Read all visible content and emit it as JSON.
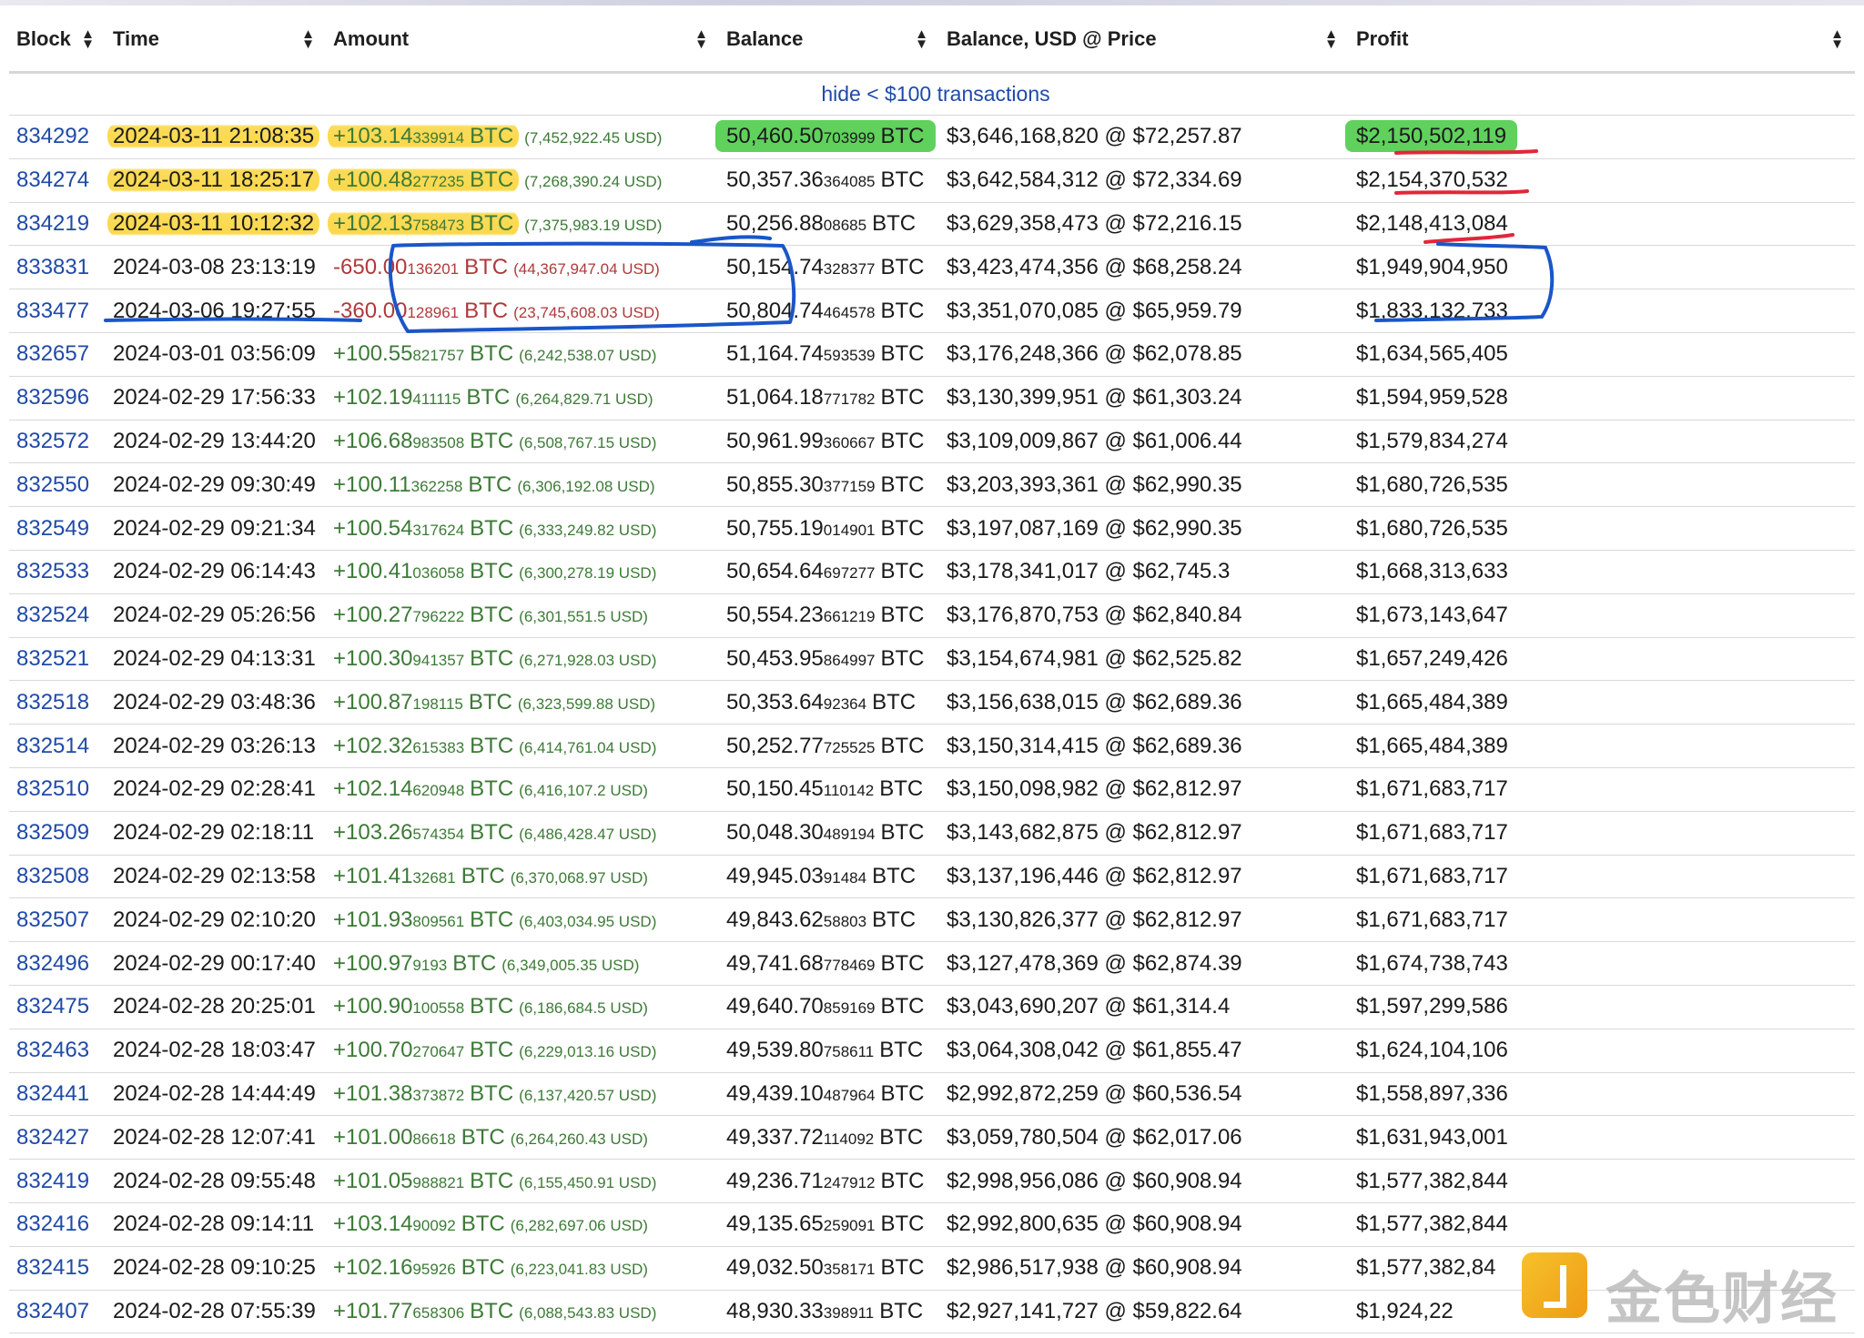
{
  "table": {
    "columns": [
      {
        "key": "block",
        "label": "Block"
      },
      {
        "key": "time",
        "label": "Time"
      },
      {
        "key": "amount",
        "label": "Amount"
      },
      {
        "key": "balance",
        "label": "Balance"
      },
      {
        "key": "balance_usd",
        "label": "Balance, USD @ Price"
      },
      {
        "key": "profit",
        "label": "Profit"
      }
    ],
    "hide_link": "hide < $100 transactions",
    "btc_unit": "BTC",
    "rows": [
      {
        "block": "834292",
        "time": "2024-03-11 21:08:35",
        "amt_main": "+103.14",
        "amt_small": "339914",
        "amt_usd": "(7,452,922.45 USD)",
        "bal_main": "50,460.50",
        "bal_small": "703999",
        "bal_usd": "$3,646,168,820 @ $72,257.87",
        "profit": "$2,150,502,119",
        "sign": "pos",
        "hl_time": true,
        "hl_amt": true,
        "hl_bal": true,
        "hl_profit": true
      },
      {
        "block": "834274",
        "time": "2024-03-11 18:25:17",
        "amt_main": "+100.48",
        "amt_small": "277235",
        "amt_usd": "(7,268,390.24 USD)",
        "bal_main": "50,357.36",
        "bal_small": "364085",
        "bal_usd": "$3,642,584,312 @ $72,334.69",
        "profit": "$2,154,370,532",
        "sign": "pos",
        "hl_time": true,
        "hl_amt": true
      },
      {
        "block": "834219",
        "time": "2024-03-11 10:12:32",
        "amt_main": "+102.13",
        "amt_small": "758473",
        "amt_usd": "(7,375,983.19 USD)",
        "bal_main": "50,256.88",
        "bal_small": "08685",
        "bal_usd": "$3,629,358,473 @ $72,216.15",
        "profit": "$2,148,413,084",
        "sign": "pos",
        "hl_time": true,
        "hl_amt": true
      },
      {
        "block": "833831",
        "time": "2024-03-08 23:13:19",
        "amt_main": "-650.00",
        "amt_small": "136201",
        "amt_usd": "(44,367,947.04 USD)",
        "bal_main": "50,154.74",
        "bal_small": "328377",
        "bal_usd": "$3,423,474,356 @ $68,258.24",
        "profit": "$1,949,904,950",
        "sign": "neg"
      },
      {
        "block": "833477",
        "time": "2024-03-06 19:27:55",
        "amt_main": "-360.00",
        "amt_small": "128961",
        "amt_usd": "(23,745,608.03 USD)",
        "bal_main": "50,804.74",
        "bal_small": "464578",
        "bal_usd": "$3,351,070,085 @ $65,959.79",
        "profit": "$1,833,132,733",
        "sign": "neg"
      },
      {
        "block": "832657",
        "time": "2024-03-01 03:56:09",
        "amt_main": "+100.55",
        "amt_small": "821757",
        "amt_usd": "(6,242,538.07 USD)",
        "bal_main": "51,164.74",
        "bal_small": "593539",
        "bal_usd": "$3,176,248,366 @ $62,078.85",
        "profit": "$1,634,565,405",
        "sign": "pos"
      },
      {
        "block": "832596",
        "time": "2024-02-29 17:56:33",
        "amt_main": "+102.19",
        "amt_small": "411115",
        "amt_usd": "(6,264,829.71 USD)",
        "bal_main": "51,064.18",
        "bal_small": "771782",
        "bal_usd": "$3,130,399,951 @ $61,303.24",
        "profit": "$1,594,959,528",
        "sign": "pos"
      },
      {
        "block": "832572",
        "time": "2024-02-29 13:44:20",
        "amt_main": "+106.68",
        "amt_small": "983508",
        "amt_usd": "(6,508,767.15 USD)",
        "bal_main": "50,961.99",
        "bal_small": "360667",
        "bal_usd": "$3,109,009,867 @ $61,006.44",
        "profit": "$1,579,834,274",
        "sign": "pos"
      },
      {
        "block": "832550",
        "time": "2024-02-29 09:30:49",
        "amt_main": "+100.11",
        "amt_small": "362258",
        "amt_usd": "(6,306,192.08 USD)",
        "bal_main": "50,855.30",
        "bal_small": "377159",
        "bal_usd": "$3,203,393,361 @ $62,990.35",
        "profit": "$1,680,726,535",
        "sign": "pos"
      },
      {
        "block": "832549",
        "time": "2024-02-29 09:21:34",
        "amt_main": "+100.54",
        "amt_small": "317624",
        "amt_usd": "(6,333,249.82 USD)",
        "bal_main": "50,755.19",
        "bal_small": "014901",
        "bal_usd": "$3,197,087,169 @ $62,990.35",
        "profit": "$1,680,726,535",
        "sign": "pos"
      },
      {
        "block": "832533",
        "time": "2024-02-29 06:14:43",
        "amt_main": "+100.41",
        "amt_small": "036058",
        "amt_usd": "(6,300,278.19 USD)",
        "bal_main": "50,654.64",
        "bal_small": "697277",
        "bal_usd": "$3,178,341,017 @ $62,745.3",
        "profit": "$1,668,313,633",
        "sign": "pos"
      },
      {
        "block": "832524",
        "time": "2024-02-29 05:26:56",
        "amt_main": "+100.27",
        "amt_small": "796222",
        "amt_usd": "(6,301,551.5 USD)",
        "bal_main": "50,554.23",
        "bal_small": "661219",
        "bal_usd": "$3,176,870,753 @ $62,840.84",
        "profit": "$1,673,143,647",
        "sign": "pos"
      },
      {
        "block": "832521",
        "time": "2024-02-29 04:13:31",
        "amt_main": "+100.30",
        "amt_small": "941357",
        "amt_usd": "(6,271,928.03 USD)",
        "bal_main": "50,453.95",
        "bal_small": "864997",
        "bal_usd": "$3,154,674,981 @ $62,525.82",
        "profit": "$1,657,249,426",
        "sign": "pos"
      },
      {
        "block": "832518",
        "time": "2024-02-29 03:48:36",
        "amt_main": "+100.87",
        "amt_small": "198115",
        "amt_usd": "(6,323,599.88 USD)",
        "bal_main": "50,353.64",
        "bal_small": "92364",
        "bal_usd": "$3,156,638,015 @ $62,689.36",
        "profit": "$1,665,484,389",
        "sign": "pos"
      },
      {
        "block": "832514",
        "time": "2024-02-29 03:26:13",
        "amt_main": "+102.32",
        "amt_small": "615383",
        "amt_usd": "(6,414,761.04 USD)",
        "bal_main": "50,252.77",
        "bal_small": "725525",
        "bal_usd": "$3,150,314,415 @ $62,689.36",
        "profit": "$1,665,484,389",
        "sign": "pos"
      },
      {
        "block": "832510",
        "time": "2024-02-29 02:28:41",
        "amt_main": "+102.14",
        "amt_small": "620948",
        "amt_usd": "(6,416,107.2 USD)",
        "bal_main": "50,150.45",
        "bal_small": "110142",
        "bal_usd": "$3,150,098,982 @ $62,812.97",
        "profit": "$1,671,683,717",
        "sign": "pos"
      },
      {
        "block": "832509",
        "time": "2024-02-29 02:18:11",
        "amt_main": "+103.26",
        "amt_small": "574354",
        "amt_usd": "(6,486,428.47 USD)",
        "bal_main": "50,048.30",
        "bal_small": "489194",
        "bal_usd": "$3,143,682,875 @ $62,812.97",
        "profit": "$1,671,683,717",
        "sign": "pos"
      },
      {
        "block": "832508",
        "time": "2024-02-29 02:13:58",
        "amt_main": "+101.41",
        "amt_small": "32681",
        "amt_usd": "(6,370,068.97 USD)",
        "bal_main": "49,945.03",
        "bal_small": "91484",
        "bal_usd": "$3,137,196,446 @ $62,812.97",
        "profit": "$1,671,683,717",
        "sign": "pos"
      },
      {
        "block": "832507",
        "time": "2024-02-29 02:10:20",
        "amt_main": "+101.93",
        "amt_small": "809561",
        "amt_usd": "(6,403,034.95 USD)",
        "bal_main": "49,843.62",
        "bal_small": "58803",
        "bal_usd": "$3,130,826,377 @ $62,812.97",
        "profit": "$1,671,683,717",
        "sign": "pos"
      },
      {
        "block": "832496",
        "time": "2024-02-29 00:17:40",
        "amt_main": "+100.97",
        "amt_small": "9193",
        "amt_usd": "(6,349,005.35 USD)",
        "bal_main": "49,741.68",
        "bal_small": "778469",
        "bal_usd": "$3,127,478,369 @ $62,874.39",
        "profit": "$1,674,738,743",
        "sign": "pos"
      },
      {
        "block": "832475",
        "time": "2024-02-28 20:25:01",
        "amt_main": "+100.90",
        "amt_small": "100558",
        "amt_usd": "(6,186,684.5 USD)",
        "bal_main": "49,640.70",
        "bal_small": "859169",
        "bal_usd": "$3,043,690,207 @ $61,314.4",
        "profit": "$1,597,299,586",
        "sign": "pos"
      },
      {
        "block": "832463",
        "time": "2024-02-28 18:03:47",
        "amt_main": "+100.70",
        "amt_small": "270647",
        "amt_usd": "(6,229,013.16 USD)",
        "bal_main": "49,539.80",
        "bal_small": "758611",
        "bal_usd": "$3,064,308,042 @ $61,855.47",
        "profit": "$1,624,104,106",
        "sign": "pos"
      },
      {
        "block": "832441",
        "time": "2024-02-28 14:44:49",
        "amt_main": "+101.38",
        "amt_small": "373872",
        "amt_usd": "(6,137,420.57 USD)",
        "bal_main": "49,439.10",
        "bal_small": "487964",
        "bal_usd": "$2,992,872,259 @ $60,536.54",
        "profit": "$1,558,897,336",
        "sign": "pos"
      },
      {
        "block": "832427",
        "time": "2024-02-28 12:07:41",
        "amt_main": "+101.00",
        "amt_small": "86618",
        "amt_usd": "(6,264,260.43 USD)",
        "bal_main": "49,337.72",
        "bal_small": "114092",
        "bal_usd": "$3,059,780,504 @ $62,017.06",
        "profit": "$1,631,943,001",
        "sign": "pos"
      },
      {
        "block": "832419",
        "time": "2024-02-28 09:55:48",
        "amt_main": "+101.05",
        "amt_small": "988821",
        "amt_usd": "(6,155,450.91 USD)",
        "bal_main": "49,236.71",
        "bal_small": "247912",
        "bal_usd": "$2,998,956,086 @ $60,908.94",
        "profit": "$1,577,382,844",
        "sign": "pos"
      },
      {
        "block": "832416",
        "time": "2024-02-28 09:14:11",
        "amt_main": "+103.14",
        "amt_small": "90092",
        "amt_usd": "(6,282,697.06 USD)",
        "bal_main": "49,135.65",
        "bal_small": "259091",
        "bal_usd": "$2,992,800,635 @ $60,908.94",
        "profit": "$1,577,382,844",
        "sign": "pos"
      },
      {
        "block": "832415",
        "time": "2024-02-28 09:10:25",
        "amt_main": "+102.16",
        "amt_small": "95926",
        "amt_usd": "(6,223,041.83 USD)",
        "bal_main": "49,032.50",
        "bal_small": "358171",
        "bal_usd": "$2,986,517,938 @ $60,908.94",
        "profit": "$1,577,382,84",
        "sign": "pos"
      },
      {
        "block": "832407",
        "time": "2024-02-28 07:55:39",
        "amt_main": "+101.77",
        "amt_small": "658306",
        "amt_usd": "(6,088,543.83 USD)",
        "bal_main": "48,930.33",
        "bal_small": "398911",
        "bal_usd": "$2,927,141,727 @ $59,822.64",
        "profit": "$1,924,22",
        "sign": "pos"
      }
    ]
  },
  "watermark": {
    "text": "金色财经",
    "icon": "jinse-logo-icon"
  },
  "annotation_colors": {
    "highlight_yellow": "#fbd94c",
    "highlight_green": "#5fd15c",
    "ink_red": "#e3263a",
    "ink_blue": "#1a56c8"
  }
}
